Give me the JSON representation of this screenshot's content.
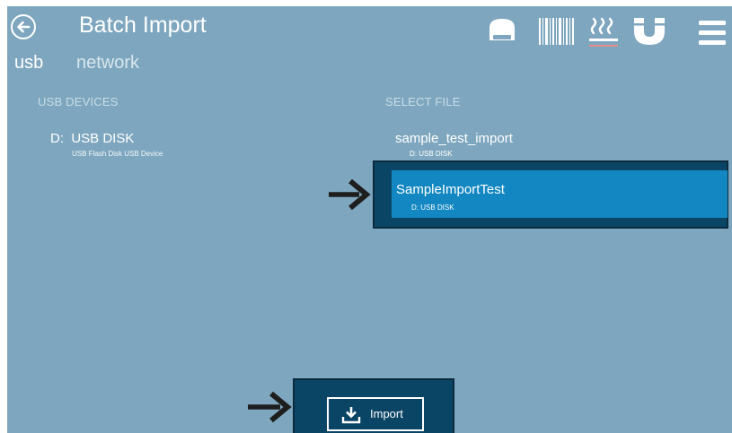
{
  "header": {
    "back_icon": "back-arrow-icon",
    "title": "Batch Import",
    "toolbar_icons": [
      "tube-icon",
      "barcode-icon",
      "heat-icon",
      "magnet-icon",
      "menu-icon"
    ]
  },
  "tabs": [
    {
      "label": "usb",
      "active": true
    },
    {
      "label": "network",
      "active": false
    }
  ],
  "usb_devices": {
    "label": "USB DEVICES",
    "items": [
      {
        "name": "D:  USB DISK",
        "description": "USB Flash Disk USB Device"
      }
    ]
  },
  "select_file": {
    "label": "SELECT FILE",
    "files": [
      {
        "name": "sample_test_import",
        "location": "D: USB DISK",
        "selected": false
      },
      {
        "name": "SampleImportTest",
        "location": "D: USB DISK",
        "selected": true
      }
    ]
  },
  "import_button": {
    "label": "Import",
    "icon": "download-icon"
  },
  "colors": {
    "background": "#7ea7bf",
    "highlight_dark": "#0b4566",
    "selected_blue": "#1287c1",
    "active_tab": "#ffffff",
    "inactive_tab": "#d8e6ee"
  }
}
